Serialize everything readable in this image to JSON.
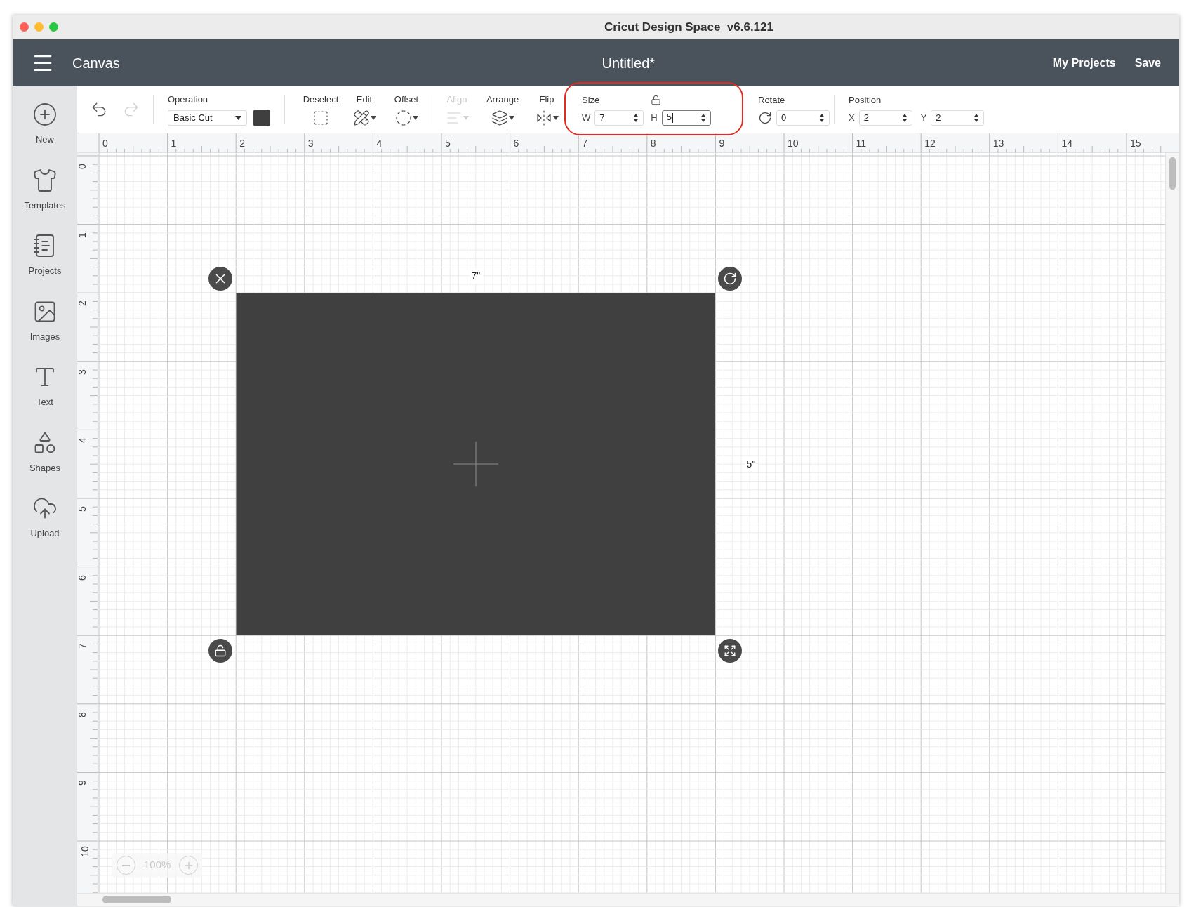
{
  "window": {
    "title": "Cricut Design Space  v6.6.121"
  },
  "header": {
    "section": "Canvas",
    "document_title": "Untitled*",
    "actions": [
      "My Projects",
      "Save"
    ]
  },
  "sidebar": {
    "items": [
      {
        "label": "New"
      },
      {
        "label": "Templates"
      },
      {
        "label": "Projects"
      },
      {
        "label": "Images"
      },
      {
        "label": "Text"
      },
      {
        "label": "Shapes"
      },
      {
        "label": "Upload"
      }
    ]
  },
  "toolbar": {
    "history": [
      {
        "kind": "undo",
        "disabled": false
      },
      {
        "kind": "redo",
        "disabled": true
      }
    ],
    "operation": {
      "label": "Operation",
      "value": "Basic Cut"
    },
    "tools": [
      {
        "label": "Deselect",
        "disabled": false,
        "dropdown": false
      },
      {
        "label": "Edit",
        "disabled": false,
        "dropdown": true
      },
      {
        "label": "Offset",
        "disabled": false,
        "dropdown": true
      },
      {
        "label": "Align",
        "disabled": true,
        "dropdown": true
      },
      {
        "label": "Arrange",
        "disabled": false,
        "dropdown": true
      },
      {
        "label": "Flip",
        "disabled": false,
        "dropdown": true
      }
    ],
    "size": {
      "label": "Size",
      "locked": false,
      "fields": [
        {
          "axis": "W",
          "value": "7",
          "focused": false
        },
        {
          "axis": "H",
          "value": "5",
          "focused": true
        }
      ]
    },
    "rotate": {
      "label": "Rotate",
      "value": "0"
    },
    "position": {
      "label": "Position",
      "fields": [
        {
          "axis": "X",
          "value": "2"
        },
        {
          "axis": "Y",
          "value": "2"
        }
      ]
    }
  },
  "rulers": {
    "horizontal": [
      "0",
      "1",
      "2",
      "3",
      "4",
      "5",
      "6",
      "7",
      "8",
      "9",
      "10",
      "11",
      "12",
      "13",
      "14",
      "15"
    ],
    "vertical": [
      "0",
      "1",
      "2",
      "3",
      "4",
      "5",
      "6",
      "7",
      "8",
      "9",
      "10"
    ]
  },
  "canvas": {
    "width_label": "7\"",
    "height_label": "5\"",
    "zoom": "100%"
  }
}
